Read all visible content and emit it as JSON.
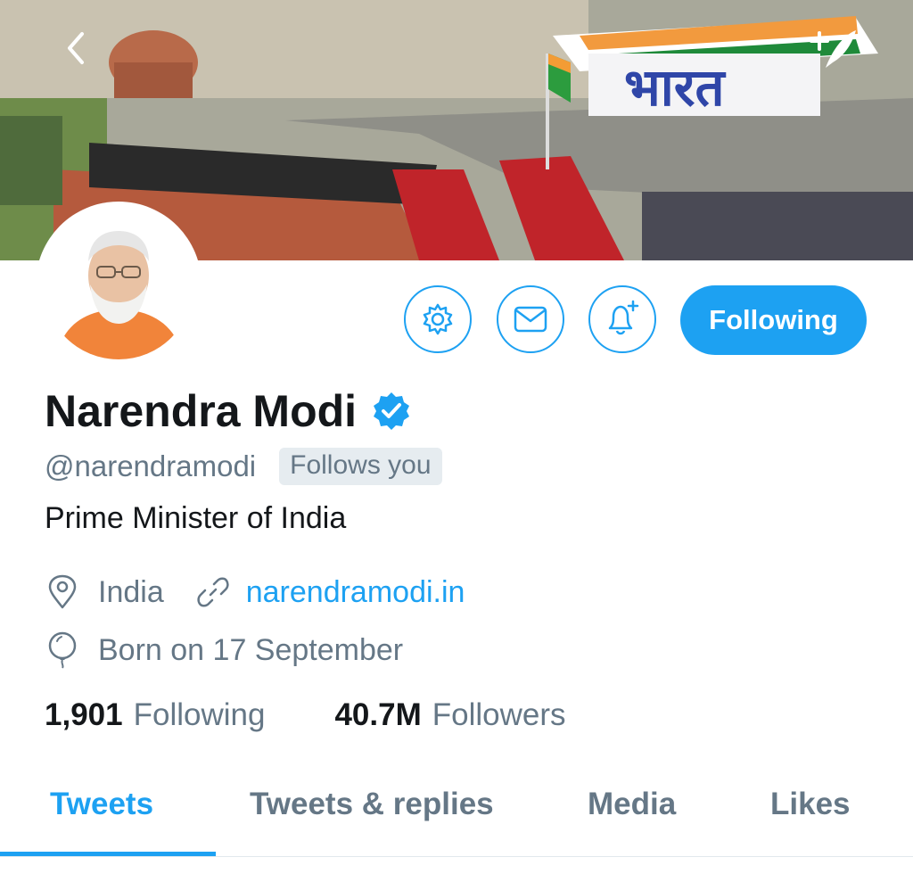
{
  "banner": {
    "back_icon": "chevron-left-icon",
    "compose_icon": "compose-tweet-icon",
    "banner_text": "भारत"
  },
  "profile": {
    "name": "Narendra Modi",
    "verified_icon": "verified-badge-icon",
    "handle": "@narendramodi",
    "follows_you": "Follows you",
    "bio": "Prime Minister of India",
    "location": "India",
    "website": "narendramodi.in",
    "birthday": "Born on 17 September"
  },
  "actions": {
    "settings_icon": "gear-icon",
    "message_icon": "envelope-icon",
    "notify_icon": "bell-plus-icon",
    "follow_label": "Following"
  },
  "stats": {
    "following_count": "1,901",
    "following_label": "Following",
    "followers_count": "40.7M",
    "followers_label": "Followers"
  },
  "tabs": [
    {
      "label": "Tweets",
      "active": true
    },
    {
      "label": "Tweets & replies",
      "active": false
    },
    {
      "label": "Media",
      "active": false
    },
    {
      "label": "Likes",
      "active": false
    }
  ],
  "colors": {
    "accent": "#1da1f2",
    "text_primary": "#14171a",
    "text_secondary": "#657786",
    "follows_you_bg": "#e6ecf0"
  }
}
